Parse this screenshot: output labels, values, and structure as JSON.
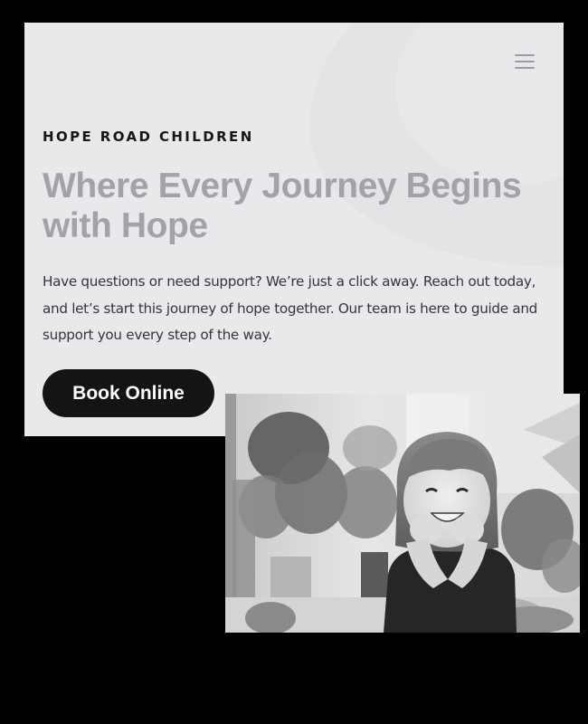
{
  "header": {
    "brand": "HOPE ROAD CHILDREN",
    "menu_icon": "hamburger-menu-icon"
  },
  "hero": {
    "headline": "Where Every Journey Begins with Hope",
    "body": "Have questions or need support? We’re just a click away. Reach out today, and let’s start this journey of hope together. Our team is here to guide and support you every step of the way.",
    "cta_label": "Book Online"
  },
  "photo": {
    "description_icon": "child-photo"
  },
  "colors": {
    "page_background": "#000000",
    "card_background": "#e9e9ec",
    "headline": "#a2a3a8",
    "body_text": "#35363a",
    "button_background": "#141416",
    "button_text": "#ffffff"
  }
}
